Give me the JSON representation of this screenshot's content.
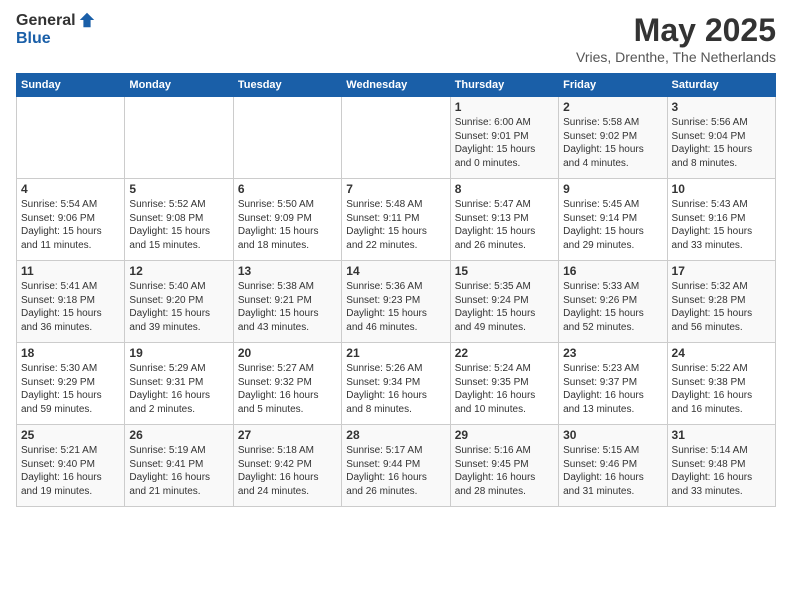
{
  "header": {
    "logo_general": "General",
    "logo_blue": "Blue",
    "title": "May 2025",
    "location": "Vries, Drenthe, The Netherlands"
  },
  "weekdays": [
    "Sunday",
    "Monday",
    "Tuesday",
    "Wednesday",
    "Thursday",
    "Friday",
    "Saturday"
  ],
  "weeks": [
    [
      {
        "day": "",
        "info": ""
      },
      {
        "day": "",
        "info": ""
      },
      {
        "day": "",
        "info": ""
      },
      {
        "day": "",
        "info": ""
      },
      {
        "day": "1",
        "info": "Sunrise: 6:00 AM\nSunset: 9:01 PM\nDaylight: 15 hours\nand 0 minutes."
      },
      {
        "day": "2",
        "info": "Sunrise: 5:58 AM\nSunset: 9:02 PM\nDaylight: 15 hours\nand 4 minutes."
      },
      {
        "day": "3",
        "info": "Sunrise: 5:56 AM\nSunset: 9:04 PM\nDaylight: 15 hours\nand 8 minutes."
      }
    ],
    [
      {
        "day": "4",
        "info": "Sunrise: 5:54 AM\nSunset: 9:06 PM\nDaylight: 15 hours\nand 11 minutes."
      },
      {
        "day": "5",
        "info": "Sunrise: 5:52 AM\nSunset: 9:08 PM\nDaylight: 15 hours\nand 15 minutes."
      },
      {
        "day": "6",
        "info": "Sunrise: 5:50 AM\nSunset: 9:09 PM\nDaylight: 15 hours\nand 18 minutes."
      },
      {
        "day": "7",
        "info": "Sunrise: 5:48 AM\nSunset: 9:11 PM\nDaylight: 15 hours\nand 22 minutes."
      },
      {
        "day": "8",
        "info": "Sunrise: 5:47 AM\nSunset: 9:13 PM\nDaylight: 15 hours\nand 26 minutes."
      },
      {
        "day": "9",
        "info": "Sunrise: 5:45 AM\nSunset: 9:14 PM\nDaylight: 15 hours\nand 29 minutes."
      },
      {
        "day": "10",
        "info": "Sunrise: 5:43 AM\nSunset: 9:16 PM\nDaylight: 15 hours\nand 33 minutes."
      }
    ],
    [
      {
        "day": "11",
        "info": "Sunrise: 5:41 AM\nSunset: 9:18 PM\nDaylight: 15 hours\nand 36 minutes."
      },
      {
        "day": "12",
        "info": "Sunrise: 5:40 AM\nSunset: 9:20 PM\nDaylight: 15 hours\nand 39 minutes."
      },
      {
        "day": "13",
        "info": "Sunrise: 5:38 AM\nSunset: 9:21 PM\nDaylight: 15 hours\nand 43 minutes."
      },
      {
        "day": "14",
        "info": "Sunrise: 5:36 AM\nSunset: 9:23 PM\nDaylight: 15 hours\nand 46 minutes."
      },
      {
        "day": "15",
        "info": "Sunrise: 5:35 AM\nSunset: 9:24 PM\nDaylight: 15 hours\nand 49 minutes."
      },
      {
        "day": "16",
        "info": "Sunrise: 5:33 AM\nSunset: 9:26 PM\nDaylight: 15 hours\nand 52 minutes."
      },
      {
        "day": "17",
        "info": "Sunrise: 5:32 AM\nSunset: 9:28 PM\nDaylight: 15 hours\nand 56 minutes."
      }
    ],
    [
      {
        "day": "18",
        "info": "Sunrise: 5:30 AM\nSunset: 9:29 PM\nDaylight: 15 hours\nand 59 minutes."
      },
      {
        "day": "19",
        "info": "Sunrise: 5:29 AM\nSunset: 9:31 PM\nDaylight: 16 hours\nand 2 minutes."
      },
      {
        "day": "20",
        "info": "Sunrise: 5:27 AM\nSunset: 9:32 PM\nDaylight: 16 hours\nand 5 minutes."
      },
      {
        "day": "21",
        "info": "Sunrise: 5:26 AM\nSunset: 9:34 PM\nDaylight: 16 hours\nand 8 minutes."
      },
      {
        "day": "22",
        "info": "Sunrise: 5:24 AM\nSunset: 9:35 PM\nDaylight: 16 hours\nand 10 minutes."
      },
      {
        "day": "23",
        "info": "Sunrise: 5:23 AM\nSunset: 9:37 PM\nDaylight: 16 hours\nand 13 minutes."
      },
      {
        "day": "24",
        "info": "Sunrise: 5:22 AM\nSunset: 9:38 PM\nDaylight: 16 hours\nand 16 minutes."
      }
    ],
    [
      {
        "day": "25",
        "info": "Sunrise: 5:21 AM\nSunset: 9:40 PM\nDaylight: 16 hours\nand 19 minutes."
      },
      {
        "day": "26",
        "info": "Sunrise: 5:19 AM\nSunset: 9:41 PM\nDaylight: 16 hours\nand 21 minutes."
      },
      {
        "day": "27",
        "info": "Sunrise: 5:18 AM\nSunset: 9:42 PM\nDaylight: 16 hours\nand 24 minutes."
      },
      {
        "day": "28",
        "info": "Sunrise: 5:17 AM\nSunset: 9:44 PM\nDaylight: 16 hours\nand 26 minutes."
      },
      {
        "day": "29",
        "info": "Sunrise: 5:16 AM\nSunset: 9:45 PM\nDaylight: 16 hours\nand 28 minutes."
      },
      {
        "day": "30",
        "info": "Sunrise: 5:15 AM\nSunset: 9:46 PM\nDaylight: 16 hours\nand 31 minutes."
      },
      {
        "day": "31",
        "info": "Sunrise: 5:14 AM\nSunset: 9:48 PM\nDaylight: 16 hours\nand 33 minutes."
      }
    ]
  ]
}
